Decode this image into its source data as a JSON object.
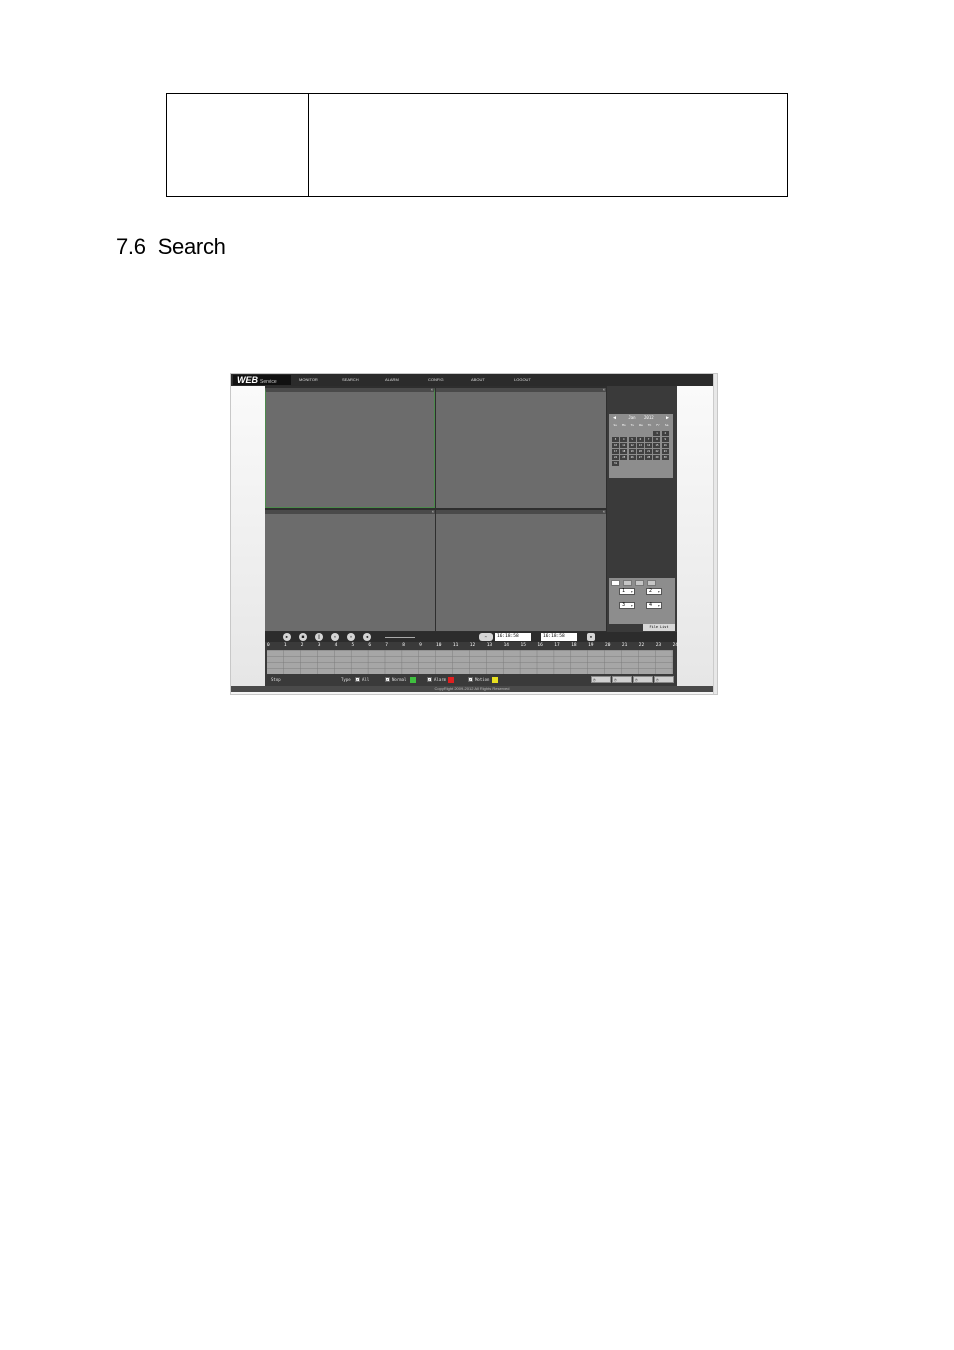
{
  "section": {
    "number": "7.6",
    "title": "Search"
  },
  "screenshot": {
    "logo": {
      "main": "WEB",
      "sub": "Service"
    },
    "menu": [
      "MONITOR",
      "SEARCH",
      "ALARM",
      "CONFIG",
      "ABOUT",
      "LOGOUT"
    ],
    "calendar": {
      "month": "Jan",
      "year": "2012",
      "weekdays": [
        "Su",
        "Mo",
        "Tu",
        "We",
        "Th",
        "Fr",
        "Sa"
      ],
      "days": [
        "",
        "",
        "",
        "",
        "",
        "1",
        "2",
        "3",
        "4",
        "5",
        "6",
        "7",
        "8",
        "9",
        "10",
        "11",
        "12",
        "13",
        "14",
        "15",
        "16",
        "17",
        "18",
        "19",
        "20",
        "21",
        "22",
        "23",
        "24",
        "25",
        "26",
        "27",
        "28",
        "29",
        "30",
        "31"
      ]
    },
    "channel_selects": [
      "1",
      "2",
      "3",
      "4"
    ],
    "file_list_label": "File List",
    "time_start": "16:18:58",
    "time_end": "16:18:58",
    "hours": [
      "0",
      "1",
      "2",
      "3",
      "4",
      "5",
      "6",
      "7",
      "8",
      "9",
      "10",
      "11",
      "12",
      "13",
      "14",
      "15",
      "16",
      "17",
      "18",
      "19",
      "20",
      "21",
      "22",
      "23",
      "24"
    ],
    "status": "Stop",
    "type_label": "Type",
    "types": [
      {
        "label": "All",
        "color": ""
      },
      {
        "label": "Normal",
        "color": "#3fbf3f"
      },
      {
        "label": "Alarm",
        "color": "#e02020"
      },
      {
        "label": "Motion",
        "color": "#e8e020"
      }
    ],
    "copyright": "CopyRight 2009-2012 All Rights Reserved"
  }
}
